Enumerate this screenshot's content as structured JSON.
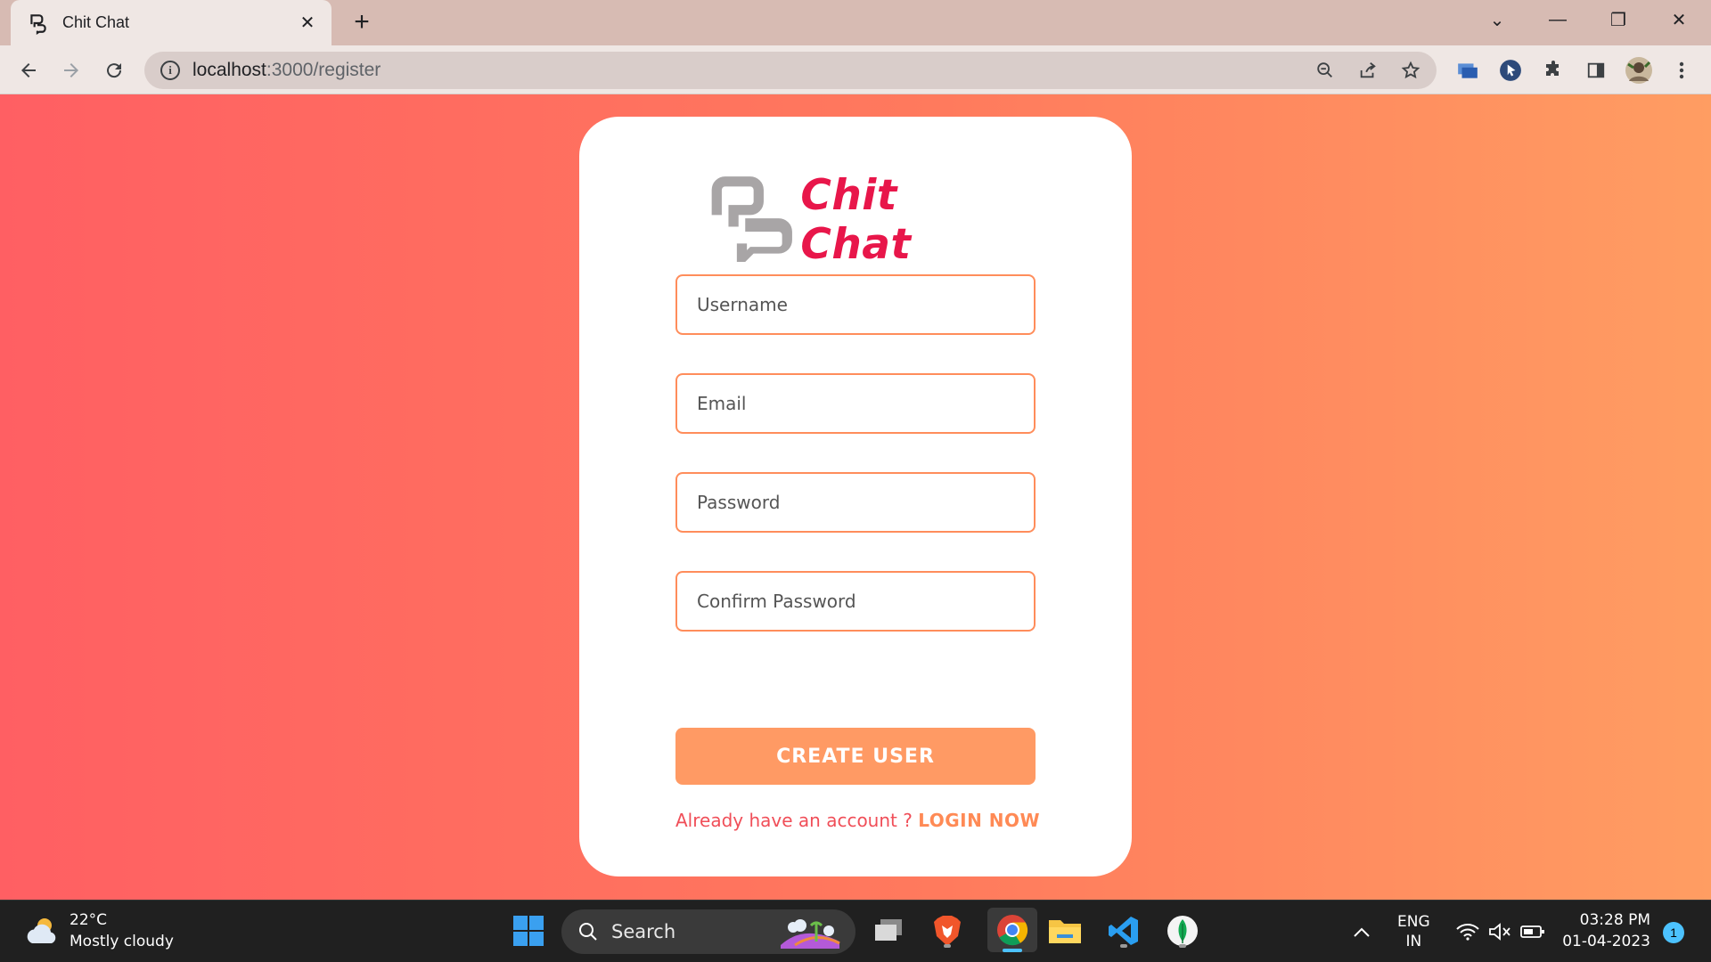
{
  "browser": {
    "tab_title": "Chit Chat",
    "tab_close": "✕",
    "new_tab": "+",
    "url_host": "localhost",
    "url_path": ":3000/register",
    "window_controls": {
      "dropdown": "⌄",
      "minimize": "—",
      "restore": "❐",
      "close": "✕"
    }
  },
  "app": {
    "brand_name": "Chit Chat",
    "colors": {
      "brand": "#e8164a",
      "accent": "#ff9a64",
      "field_border": "#ff8d5b",
      "gradient_start": "#ff5f63",
      "gradient_end": "#ff9d62"
    },
    "form": {
      "username_placeholder": "Username",
      "email_placeholder": "Email",
      "password_placeholder": "Password",
      "confirm_password_placeholder": "Confirm Password",
      "submit_label": "CREATE USER",
      "login_prompt": "Already have an account ? ",
      "login_link": "LOGIN NOW"
    }
  },
  "taskbar": {
    "weather_temp": "22°C",
    "weather_desc": "Mostly cloudy",
    "search_label": "Search",
    "language_primary": "ENG",
    "language_secondary": "IN",
    "time": "03:28 PM",
    "date": "01-04-2023",
    "notification_count": "1"
  }
}
